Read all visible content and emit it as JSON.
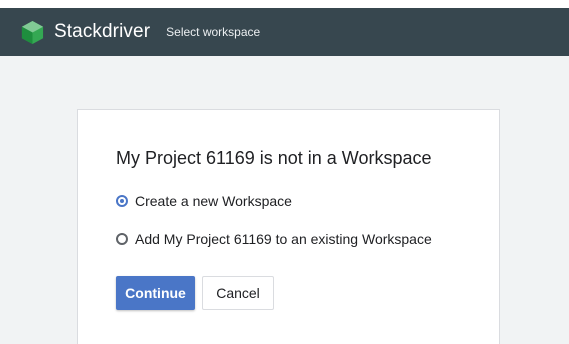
{
  "header": {
    "brand": "Stackdriver",
    "subtitle": "Select workspace",
    "logo_icon": "stackdriver-hexagon-logo",
    "background_color": "#37474f",
    "logo_colors": [
      "#0f9d58",
      "#57bb8a",
      "#34a853"
    ]
  },
  "dialog": {
    "title": "My Project 61169 is not in a Workspace",
    "options": [
      {
        "label": "Create a new Workspace",
        "selected": true
      },
      {
        "label": "Add My Project 61169 to an existing Workspace",
        "selected": false
      }
    ],
    "continue_label": "Continue",
    "cancel_label": "Cancel",
    "accent_color": "#4a76c7"
  }
}
